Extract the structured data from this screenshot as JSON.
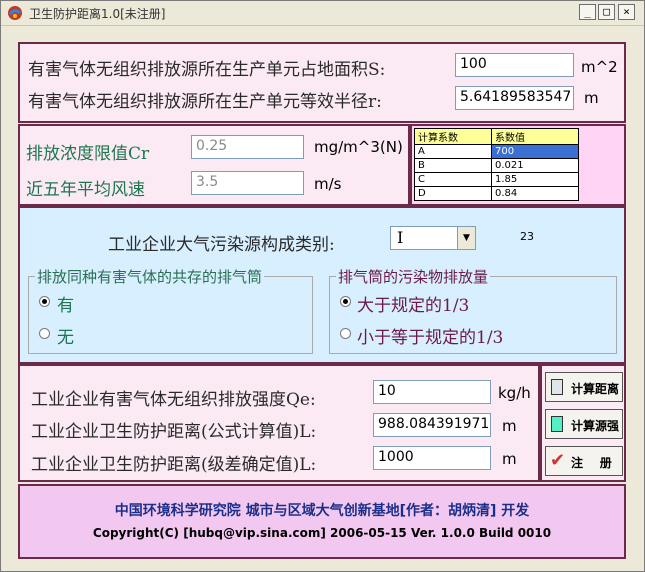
{
  "window": {
    "title": "卫生防护距离1.0[未注册]",
    "controls": {
      "minimize": "_",
      "maximize": "□",
      "close": "×"
    }
  },
  "source": {
    "area_label": "有害气体无组织排放源所在生产单元占地面积S:",
    "area_value": "100",
    "area_unit": "m^2",
    "radius_label": "有害气体无组织排放源所在生产单元等效半径r:",
    "radius_value": "5.64189583547",
    "radius_unit": "m"
  },
  "params": {
    "cr_label": "排放浓度限值Cr",
    "cr_value": "0.25",
    "cr_unit": "mg/m^3(N)",
    "wind_label": "近五年平均风速",
    "wind_value": "3.5",
    "wind_unit": "m/s"
  },
  "coef_table": {
    "headers": [
      "计算系数",
      "系数值"
    ],
    "rows": [
      {
        "name": "A",
        "value": "700"
      },
      {
        "name": "B",
        "value": "0.021"
      },
      {
        "name": "C",
        "value": "1.85"
      },
      {
        "name": "D",
        "value": "0.84"
      }
    ]
  },
  "category": {
    "label": "工业企业大气污染源构成类别:",
    "selected": "I",
    "side_number": "23"
  },
  "group1": {
    "legend": "排放同种有害气体的共存的排气筒",
    "options": [
      {
        "label": "有",
        "checked": true
      },
      {
        "label": "无",
        "checked": false
      }
    ]
  },
  "group2": {
    "legend": "排气筒的污染物排放量",
    "options": [
      {
        "label": "大于规定的1/3",
        "checked": true
      },
      {
        "label": "小于等于规定的1/3",
        "checked": false
      }
    ]
  },
  "results": {
    "qe_label": "工业企业有害气体无组织排放强度Qe:",
    "qe_value": "10",
    "qe_unit": "kg/h",
    "formula_label": "工业企业卫生防护距离(公式计算值)L:",
    "formula_value": "988.084391971",
    "formula_unit": "m",
    "level_label": "工业企业卫生防护距离(级差确定值)L:",
    "level_value": "1000",
    "level_unit": "m"
  },
  "buttons": {
    "calc_distance": "计算距离",
    "calc_source": "计算源强",
    "register": "注    册"
  },
  "footer": {
    "line1": "中国环境科学研究院  城市与区域大气创新基地[作者：胡炳清] 开发",
    "line2": "Copyright(C) [hubq@vip.sina.com]  2006-05-15 Ver. 1.0.0 Build 0010"
  },
  "colors": {
    "panel_border": "#6b2a4a",
    "panel_pink": "#fbeaf3",
    "panel_blue": "#d7efff",
    "label_green": "#1e7650",
    "footer_title": "#1b2f8a",
    "selection": "#3b6fd4"
  }
}
